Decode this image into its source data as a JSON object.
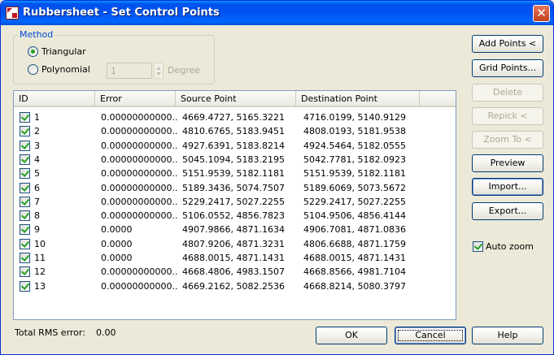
{
  "window": {
    "title": "Rubbersheet - Set Control Points",
    "close_symbol": "✕",
    "icon": "app-icon"
  },
  "method": {
    "legend": "Method",
    "options": [
      {
        "label": "Triangular",
        "checked": true
      },
      {
        "label": "Polynomial",
        "checked": false
      }
    ],
    "degree_value": "1",
    "degree_label": "Degree"
  },
  "list": {
    "columns": [
      "ID",
      "Error",
      "Source Point",
      "Destination Point"
    ],
    "rows": [
      {
        "id": "1",
        "error": "0.00000000000...",
        "source": "4669.4727, 5165.3221",
        "dest": "4716.0199, 5140.9129",
        "checked": true
      },
      {
        "id": "2",
        "error": "0.00000000000...",
        "source": "4810.6765, 5183.9451",
        "dest": "4808.0193, 5181.9538",
        "checked": true
      },
      {
        "id": "3",
        "error": "0.00000000000...",
        "source": "4927.6391, 5183.8214",
        "dest": "4924.5464, 5182.0555",
        "checked": true
      },
      {
        "id": "4",
        "error": "0.00000000000...",
        "source": "5045.1094, 5183.2195",
        "dest": "5042.7781, 5182.0923",
        "checked": true
      },
      {
        "id": "5",
        "error": "0.00000000000...",
        "source": "5151.9539, 5182.1181",
        "dest": "5151.9539, 5182.1181",
        "checked": true
      },
      {
        "id": "6",
        "error": "0.00000000000...",
        "source": "5189.3436, 5074.7507",
        "dest": "5189.6069, 5073.5672",
        "checked": true
      },
      {
        "id": "7",
        "error": "0.00000000000...",
        "source": "5229.2417, 5027.2255",
        "dest": "5229.2417, 5027.2255",
        "checked": true
      },
      {
        "id": "8",
        "error": "0.00000000000...",
        "source": "5106.0552, 4856.7823",
        "dest": "5104.9506, 4856.4144",
        "checked": true
      },
      {
        "id": "9",
        "error": "0.0000",
        "source": "4907.9866, 4871.1634",
        "dest": "4906.7081, 4871.0836",
        "checked": true
      },
      {
        "id": "10",
        "error": "0.0000",
        "source": "4807.9206, 4871.3231",
        "dest": "4806.6688, 4871.1759",
        "checked": true
      },
      {
        "id": "11",
        "error": "0.0000",
        "source": "4688.0015, 4871.1431",
        "dest": "4688.0015, 4871.1431",
        "checked": true
      },
      {
        "id": "12",
        "error": "0.00000000000...",
        "source": "4668.4806, 4983.1507",
        "dest": "4668.8566, 4981.7104",
        "checked": true
      },
      {
        "id": "13",
        "error": "0.00000000000...",
        "source": "4669.2162, 5082.2536",
        "dest": "4668.8214, 5080.3797",
        "checked": true
      }
    ]
  },
  "buttons": {
    "add_points": "Add Points <",
    "grid_points": "Grid Points...",
    "delete": "Delete",
    "repick": "Repick <",
    "zoom_to": "Zoom To <",
    "preview": "Preview",
    "import": "Import...",
    "export": "Export...",
    "ok": "OK",
    "cancel": "Cancel",
    "help": "Help"
  },
  "auto_zoom": {
    "label": "Auto zoom",
    "checked": true
  },
  "footer": {
    "rms_label": "Total RMS error:",
    "rms_value": "0.00"
  }
}
